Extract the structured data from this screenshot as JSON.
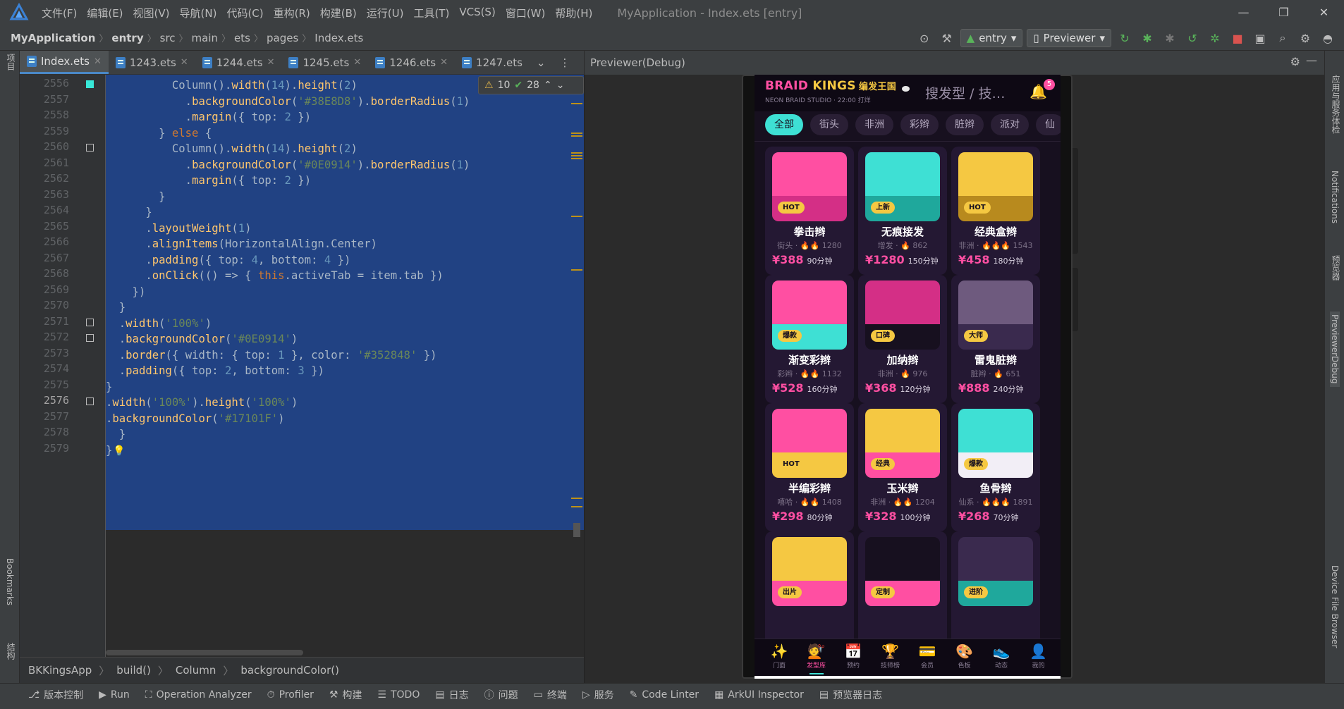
{
  "window": {
    "title": "MyApplication - Index.ets [entry]",
    "menus": [
      "文件(F)",
      "编辑(E)",
      "视图(V)",
      "导航(N)",
      "代码(C)",
      "重构(R)",
      "构建(B)",
      "运行(U)",
      "工具(T)",
      "VCS(S)",
      "窗口(W)",
      "帮助(H)"
    ],
    "controls": [
      "—",
      "❐",
      "✕"
    ]
  },
  "nav": {
    "crumbs": [
      "MyApplication",
      "entry",
      "src",
      "main",
      "ets",
      "pages",
      "Index.ets"
    ],
    "module": "entry",
    "device": "Previewer"
  },
  "left_strip": {
    "top": "项目",
    "bookmarks": "Bookmarks",
    "structure": "结构"
  },
  "right_strip": {
    "top": "应用与服务体检",
    "notifications": "Notifications",
    "preview": "预览器",
    "debug": "PreviewerDebug",
    "device": "Device File Browser"
  },
  "editor": {
    "tabs": [
      {
        "label": "Index.ets",
        "active": true
      },
      {
        "label": "1243.ets"
      },
      {
        "label": "1244.ets"
      },
      {
        "label": "1245.ets"
      },
      {
        "label": "1246.ets"
      },
      {
        "label": "1247.ets"
      }
    ],
    "inspection": {
      "warnings": "10",
      "checks": "28"
    },
    "line_numbers": [
      "2556",
      "2557",
      "2558",
      "2559",
      "2560",
      "2561",
      "2562",
      "2563",
      "2564",
      "2565",
      "2566",
      "2567",
      "2568",
      "2569",
      "2570",
      "2571",
      "2572",
      "2573",
      "2574",
      "2575",
      "2576",
      "2577",
      "2578",
      "2579"
    ],
    "code_lines": [
      "          Column().width(14).height(2)",
      "            .backgroundColor('#38E8D8').borderRadius(1)",
      "            .margin({ top: 2 })",
      "        } else {",
      "          Column().width(14).height(2)",
      "            .backgroundColor('#0E0914').borderRadius(1)",
      "            .margin({ top: 2 })",
      "        }",
      "      }",
      "      .layoutWeight(1)",
      "      .alignItems(HorizontalAlign.Center)",
      "      .padding({ top: 4, bottom: 4 })",
      "      .onClick(() => { this.activeTab = item.tab })",
      "    })",
      "  }",
      "  .width('100%')",
      "  .backgroundColor('#0E0914')",
      "  .border({ width: { top: 1 }, color: '#352848' })",
      "  .padding({ top: 2, bottom: 3 })",
      "}",
      ".width('100%').height('100%')",
      ".backgroundColor('#17101F')",
      "  }",
      "}"
    ],
    "breadcrumb": [
      "BKKingsApp",
      "build()",
      "Column",
      "backgroundColor()"
    ]
  },
  "previewer": {
    "title": "Previewer(Debug)"
  },
  "app": {
    "brand_a": "BRAID",
    "brand_b": "KINGS",
    "brand_cn": "编发王国",
    "brand_sub": "NEON BRAID STUDIO · 22:00 打烊",
    "search_placeholder": "搜发型 / 技…",
    "bell_count": "5",
    "chips": [
      "全部",
      "街头",
      "非洲",
      "彩辫",
      "脏辫",
      "派对",
      "仙"
    ],
    "active_chip": 0,
    "cards": [
      {
        "name": "拳击辫",
        "cat": "街头",
        "fire": "🔥🔥",
        "count": "1280",
        "price": "¥388",
        "dur": "90分钟",
        "badge": "HOT",
        "top": "#FF4FA2",
        "bot": "#D42F86"
      },
      {
        "name": "无痕接发",
        "cat": "增发",
        "fire": "🔥",
        "count": "862",
        "price": "¥1280",
        "dur": "150分钟",
        "badge": "上新",
        "top": "#3EE0D4",
        "bot": "#1FA89C"
      },
      {
        "name": "经典盒辫",
        "cat": "非洲",
        "fire": "🔥🔥🔥",
        "count": "1543",
        "price": "¥458",
        "dur": "180分钟",
        "badge": "HOT",
        "top": "#F5C842",
        "bot": "#B88A1E"
      },
      {
        "name": "渐变彩辫",
        "cat": "彩辫",
        "fire": "🔥🔥",
        "count": "1132",
        "price": "¥528",
        "dur": "160分钟",
        "badge": "爆款",
        "top": "#FF4FA2",
        "bot": "#3EE0D4"
      },
      {
        "name": "加纳辫",
        "cat": "非洲",
        "fire": "🔥",
        "count": "976",
        "price": "¥368",
        "dur": "120分钟",
        "badge": "口碑",
        "top": "#D42F86",
        "bot": "#17101F"
      },
      {
        "name": "雷鬼脏辫",
        "cat": "脏辫",
        "fire": "🔥",
        "count": "651",
        "price": "¥888",
        "dur": "240分钟",
        "badge": "大师",
        "top": "#6E5A7E",
        "bot": "#3A2A4E"
      },
      {
        "name": "半编彩辫",
        "cat": "嘻哈",
        "fire": "🔥🔥",
        "count": "1408",
        "price": "¥298",
        "dur": "80分钟",
        "badge": "HOT",
        "top": "#FF4FA2",
        "bot": "#F5C842"
      },
      {
        "name": "玉米辫",
        "cat": "非洲",
        "fire": "🔥🔥",
        "count": "1204",
        "price": "¥328",
        "dur": "100分钟",
        "badge": "经典",
        "top": "#F5C842",
        "bot": "#FF4FA2"
      },
      {
        "name": "鱼骨辫",
        "cat": "仙系",
        "fire": "🔥🔥🔥",
        "count": "1891",
        "price": "¥268",
        "dur": "70分钟",
        "badge": "爆款",
        "top": "#3EE0D4",
        "bot": "#F2EEF6"
      },
      {
        "name": "",
        "cat": "",
        "fire": "",
        "count": "",
        "price": "",
        "dur": "",
        "badge": "出片",
        "top": "#F5C842",
        "bot": "#FF4FA2"
      },
      {
        "name": "",
        "cat": "",
        "fire": "",
        "count": "",
        "price": "",
        "dur": "",
        "badge": "定制",
        "top": "#17101F",
        "bot": "#FF4FA2"
      },
      {
        "name": "",
        "cat": "",
        "fire": "",
        "count": "",
        "price": "",
        "dur": "",
        "badge": "进阶",
        "top": "#3A2A4E",
        "bot": "#1FA89C"
      }
    ],
    "tabbar": [
      {
        "icon": "✨",
        "label": "门面"
      },
      {
        "icon": "💇",
        "label": "发型库",
        "active": true
      },
      {
        "icon": "📅",
        "label": "预约"
      },
      {
        "icon": "🏆",
        "label": "技师榜"
      },
      {
        "icon": "💳",
        "label": "会员"
      },
      {
        "icon": "🎨",
        "label": "色板"
      },
      {
        "icon": "👟",
        "label": "动态"
      },
      {
        "icon": "👤",
        "label": "我的"
      }
    ]
  },
  "bottom_tools": [
    "版本控制",
    "Run",
    "Operation Analyzer",
    "Profiler",
    "构建",
    "TODO",
    "日志",
    "问题",
    "终端",
    "服务",
    "Code Linter",
    "ArkUI Inspector",
    "预览器日志"
  ],
  "colors": {
    "accent_pink": "#FF4FA2",
    "accent_cyan": "#3EE0D4",
    "accent_gold": "#F5C842",
    "bg": "#17101F",
    "bar": "#0E0914"
  }
}
